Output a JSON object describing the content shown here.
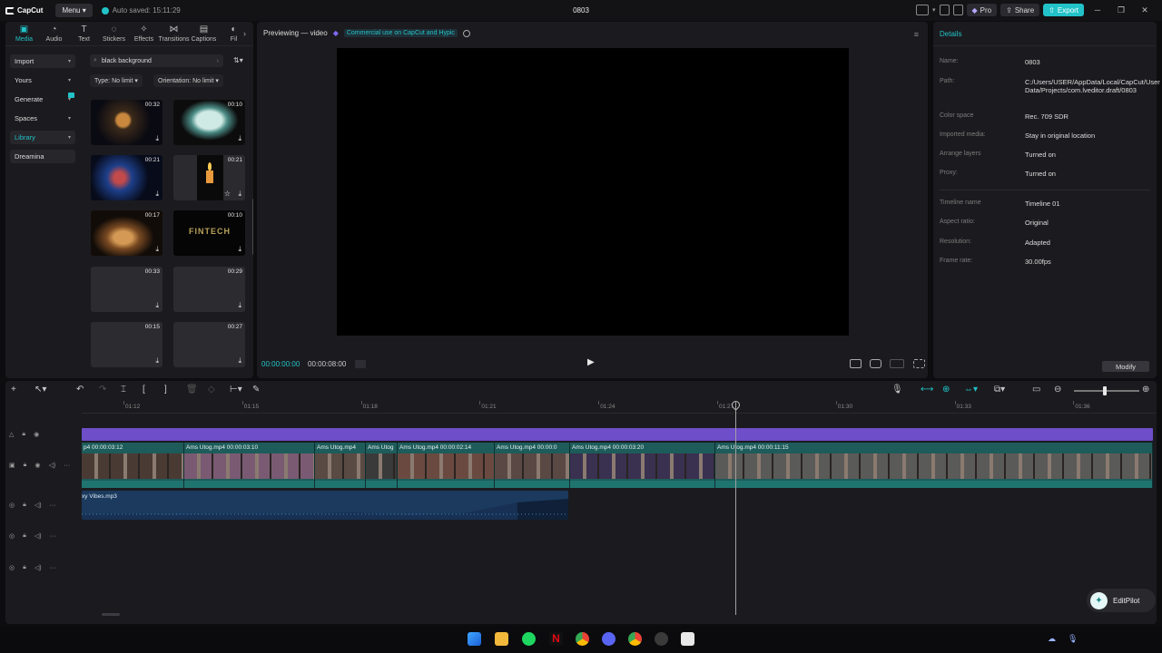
{
  "titlebar": {
    "logo": "CapCut",
    "menu_label": "Menu",
    "autosave": "Auto saved: 15:11:29",
    "project_title": "0803",
    "pro_label": "Pro",
    "share_label": "Share",
    "export_label": "Export"
  },
  "media": {
    "tabs": [
      {
        "label": "Media",
        "icon": "media-icon"
      },
      {
        "label": "Audio",
        "icon": "audio-icon"
      },
      {
        "label": "Text",
        "icon": "text-icon"
      },
      {
        "label": "Stickers",
        "icon": "stickers-icon"
      },
      {
        "label": "Effects",
        "icon": "effects-icon"
      },
      {
        "label": "Transitions",
        "icon": "transitions-icon"
      },
      {
        "label": "Captions",
        "icon": "captions-icon"
      },
      {
        "label": "Fil",
        "icon": "filters-icon"
      }
    ],
    "side": [
      "Import",
      "Yours",
      "Generate",
      "Spaces",
      "Library",
      "Dreamina"
    ],
    "search_value": "black background",
    "filter_type": "Type: No limit",
    "filter_orientation": "Orientation: No limit",
    "thumbs": [
      {
        "duration": "00:32",
        "scene": "saxophone player"
      },
      {
        "duration": "00:10",
        "scene": "keypad grid"
      },
      {
        "duration": "00:21",
        "scene": "guitarist blue light"
      },
      {
        "duration": "00:21",
        "scene": "candle flame"
      },
      {
        "duration": "00:17",
        "scene": "guitar strumming"
      },
      {
        "duration": "00:10",
        "scene": "FINTECH logo"
      },
      {
        "duration": "00:33",
        "scene": "blank"
      },
      {
        "duration": "00:29",
        "scene": "blank"
      },
      {
        "duration": "00:15",
        "scene": "blank"
      },
      {
        "duration": "00:27",
        "scene": "blank"
      }
    ],
    "thumb_text_fintech": "FINTECH"
  },
  "player": {
    "heading": "Previewing — video",
    "commercial_note": "Commercial use on CapCut and Hypic",
    "time_current": "00:00:00:00",
    "time_total": "00:00:08:00"
  },
  "details": {
    "title": "Details",
    "rows": [
      {
        "key": "Name:",
        "value": "0803"
      },
      {
        "key": "Path:",
        "value": "C:/Users/USER/AppData/Local/CapCut/User Data/Projects/com.lveditor.draft/0803"
      },
      {
        "key": "Color space",
        "value": "Rec. 709 SDR"
      },
      {
        "key": "Imported media:",
        "value": "Stay in original location"
      },
      {
        "key": "Arrange layers",
        "value": "Turned on"
      },
      {
        "key": "Proxy:",
        "value": "Turned on"
      },
      {
        "key": "Timeline name",
        "value": "Timeline 01"
      },
      {
        "key": "Aspect ratio:",
        "value": "Original"
      },
      {
        "key": "Resolution:",
        "value": "Adapted"
      },
      {
        "key": "Frame rate:",
        "value": "30.00fps"
      }
    ],
    "modify_label": "Modify"
  },
  "timeline": {
    "ticks": [
      "01:12",
      "01:15",
      "01:18",
      "01:21",
      "01:24",
      "01:27",
      "01:30",
      "01:33",
      "01:36"
    ],
    "clips": [
      {
        "label": "p4   00:00:03:12",
        "tone": "#4a3a34"
      },
      {
        "label": "Ams Utog.mp4   00:00:03:10",
        "tone": "#7a5a72"
      },
      {
        "label": "Ams Utog.mp4",
        "tone": "#5a4a44"
      },
      {
        "label": "Ams Utog",
        "tone": "#3a3a3a"
      },
      {
        "label": "Ams Utog.mp4   00:00:02:14",
        "tone": "#6a4a40"
      },
      {
        "label": "Ams Utog.mp4   00:00:0",
        "tone": "#5a4844"
      },
      {
        "label": "Ams Utog.mp4   00:00:03:20",
        "tone": "#3a3050"
      },
      {
        "label": "Ams Utog.mp4   00:00:11:15",
        "tone": "#5a5a58"
      }
    ],
    "audio_label": "xy Vibes.mp3",
    "editpilot_label": "EditPilot"
  }
}
